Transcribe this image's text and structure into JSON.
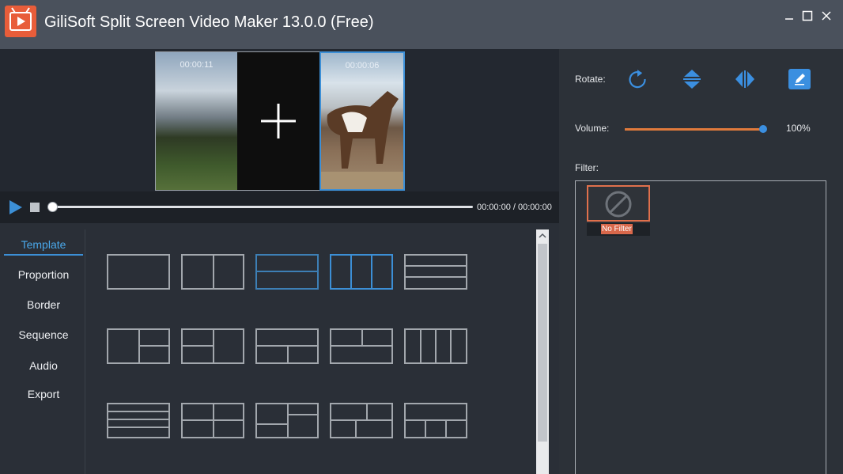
{
  "window": {
    "title": "GiliSoft Split Screen Video Maker 13.0.0 (Free)"
  },
  "preview": {
    "pane1_time": "00:00:11",
    "pane3_time": "00:00:06"
  },
  "playback": {
    "time_readout": "00:00:00 / 00:00:00"
  },
  "sidebar": {
    "items": [
      {
        "label": "Template"
      },
      {
        "label": "Proportion"
      },
      {
        "label": "Border"
      },
      {
        "label": "Sequence"
      },
      {
        "label": "Audio"
      },
      {
        "label": "Export"
      }
    ]
  },
  "right_panel": {
    "rotate_label": "Rotate:",
    "volume_label": "Volume:",
    "volume_value": "100%",
    "filter_label": "Filter:",
    "filters": [
      {
        "label": "No Filter"
      }
    ]
  },
  "colors": {
    "accent": "#3c8fd6",
    "volume": "#e07a3c",
    "filter_selected": "#e0704c"
  }
}
